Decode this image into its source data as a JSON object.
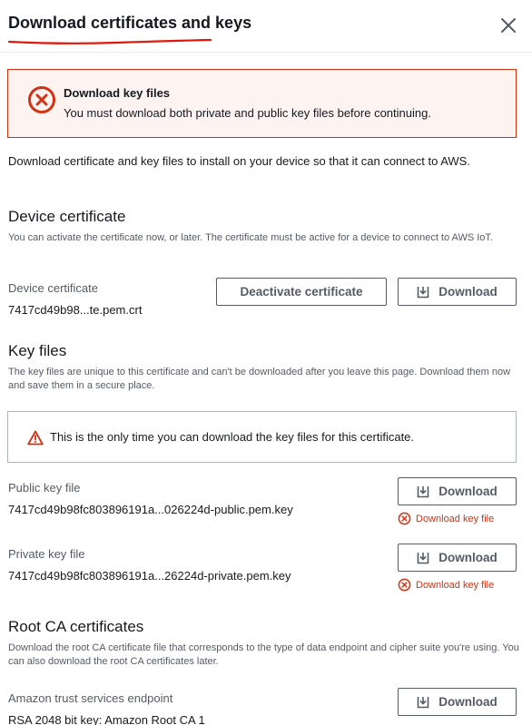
{
  "dialog": {
    "title": "Download certificates and keys",
    "close_label": "Close"
  },
  "error_alert": {
    "title": "Download key files",
    "message": "You must download both private and public key files before continuing."
  },
  "intro": "Download certificate and key files to install on your device so that it can connect to AWS.",
  "device_certificate": {
    "heading": "Device certificate",
    "description": "You can activate the certificate now, or later. The certificate must be active for a device to connect to AWS IoT.",
    "label": "Device certificate",
    "filename": "7417cd49b98...te.pem.crt",
    "deactivate_label": "Deactivate certificate",
    "download_label": "Download"
  },
  "key_files": {
    "heading": "Key files",
    "description": "The key files are unique to this certificate and can't be downloaded after you leave this page. Download them now and save them in a secure place.",
    "warning": "This is the only time you can download the key files for this certificate.",
    "public": {
      "label": "Public key file",
      "filename": "7417cd49b98fc803896191a...026224d-public.pem.key",
      "download_label": "Download",
      "error": "Download key file"
    },
    "private": {
      "label": "Private key file",
      "filename": "7417cd49b98fc803896191a...26224d-private.pem.key",
      "download_label": "Download",
      "error": "Download key file"
    }
  },
  "root_ca": {
    "heading": "Root CA certificates",
    "description": "Download the root CA certificate file that corresponds to the type of data endpoint and cipher suite you're using. You can also download the root CA certificates later.",
    "label": "Amazon trust services endpoint",
    "value": "RSA 2048 bit key: Amazon Root CA 1",
    "download_label": "Download"
  },
  "colors": {
    "error": "#d13212",
    "error_bg": "#fdf3f1",
    "text": "#16191f",
    "secondary_text": "#545b64"
  },
  "icons": {
    "close": "close-icon",
    "error": "error-circle-icon",
    "warning": "warning-triangle-icon",
    "download": "download-icon"
  }
}
